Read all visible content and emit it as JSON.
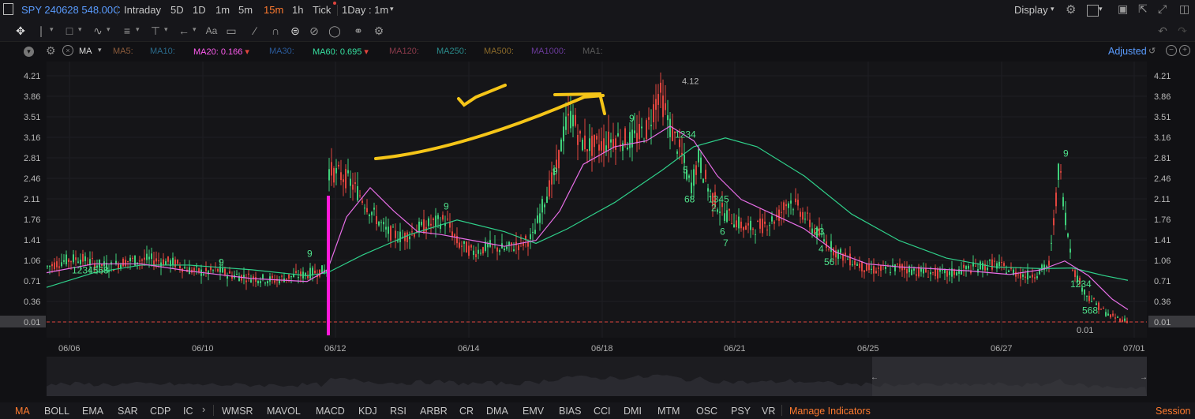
{
  "header": {
    "symbol": "SPY 240628 548.00C",
    "timeframes": [
      "Intraday",
      "5D",
      "1D",
      "1m",
      "5m",
      "15m",
      "1h",
      "Tick"
    ],
    "active_timeframe": "15m",
    "range_select": "1Day : 1m",
    "display_label": "Display"
  },
  "ma_legend": {
    "type_label": "MA",
    "items": [
      {
        "label": "MA5:",
        "value": "",
        "color": "#8a5a3a"
      },
      {
        "label": "MA10:",
        "value": "",
        "color": "#2a6a8a"
      },
      {
        "label": "MA20:",
        "value": "0.166",
        "color": "#ff5cf0"
      },
      {
        "label": "MA30:",
        "value": "",
        "color": "#2a5a9a"
      },
      {
        "label": "MA60:",
        "value": "0.695",
        "color": "#36e0a0"
      },
      {
        "label": "MA120:",
        "value": "",
        "color": "#8a3a4a"
      },
      {
        "label": "MA250:",
        "value": "",
        "color": "#2a8a8a"
      },
      {
        "label": "MA500:",
        "value": "",
        "color": "#8a6a2a"
      },
      {
        "label": "MA1000:",
        "value": "",
        "color": "#6a3a9a"
      },
      {
        "label": "MA1:",
        "value": "",
        "color": "#5a5a5a"
      }
    ],
    "adjusted_label": "Adjusted"
  },
  "chart_data": {
    "type": "candlestick",
    "y_ticks": [
      "4.21",
      "3.86",
      "3.51",
      "3.16",
      "2.81",
      "2.46",
      "2.11",
      "1.76",
      "1.41",
      "1.06",
      "0.71",
      "0.36",
      "0.01"
    ],
    "ylim": [
      0.01,
      4.21
    ],
    "x_ticks": [
      "06/06",
      "06/10",
      "06/12",
      "06/14",
      "06/18",
      "06/21",
      "06/25",
      "06/27",
      "07/01"
    ],
    "current_price": "0.01",
    "high_label": "4.12",
    "low_label": "0.01",
    "price_path": [
      [
        0,
        0.95
      ],
      [
        20,
        1.05
      ],
      [
        40,
        1.1
      ],
      [
        60,
        1.0
      ],
      [
        80,
        0.95
      ],
      [
        100,
        1.05
      ],
      [
        130,
        1.08
      ],
      [
        160,
        1.02
      ],
      [
        180,
        0.9
      ],
      [
        200,
        0.85
      ],
      [
        215,
        0.9
      ],
      [
        230,
        0.82
      ],
      [
        250,
        0.78
      ],
      [
        270,
        0.75
      ],
      [
        290,
        0.72
      ],
      [
        305,
        0.78
      ],
      [
        320,
        0.8
      ],
      [
        335,
        0.85
      ],
      [
        355,
        0.9
      ],
      [
        356,
        2.6
      ],
      [
        365,
        2.55
      ],
      [
        380,
        2.45
      ],
      [
        395,
        2.2
      ],
      [
        410,
        1.9
      ],
      [
        430,
        1.55
      ],
      [
        450,
        1.45
      ],
      [
        470,
        1.6
      ],
      [
        490,
        1.7
      ],
      [
        505,
        1.75
      ],
      [
        520,
        1.35
      ],
      [
        540,
        1.2
      ],
      [
        560,
        1.3
      ],
      [
        580,
        1.25
      ],
      [
        600,
        1.35
      ],
      [
        615,
        1.45
      ],
      [
        630,
        2.1
      ],
      [
        645,
        2.6
      ],
      [
        655,
        3.3
      ],
      [
        665,
        3.55
      ],
      [
        675,
        3.1
      ],
      [
        690,
        3.0
      ],
      [
        705,
        3.05
      ],
      [
        720,
        3.15
      ],
      [
        740,
        3.1
      ],
      [
        760,
        3.3
      ],
      [
        775,
        3.95
      ],
      [
        790,
        3.3
      ],
      [
        805,
        2.8
      ],
      [
        815,
        2.3
      ],
      [
        825,
        2.8
      ],
      [
        840,
        2.2
      ],
      [
        855,
        1.9
      ],
      [
        870,
        1.75
      ],
      [
        885,
        1.6
      ],
      [
        905,
        1.65
      ],
      [
        925,
        1.8
      ],
      [
        940,
        2.1
      ],
      [
        955,
        1.9
      ],
      [
        970,
        1.6
      ],
      [
        985,
        1.4
      ],
      [
        1000,
        1.2
      ],
      [
        1020,
        1.05
      ],
      [
        1040,
        0.9
      ],
      [
        1060,
        0.9
      ],
      [
        1080,
        0.95
      ],
      [
        1100,
        0.88
      ],
      [
        1120,
        0.85
      ],
      [
        1140,
        0.82
      ],
      [
        1160,
        0.9
      ],
      [
        1180,
        0.95
      ],
      [
        1200,
        1.0
      ],
      [
        1220,
        0.88
      ],
      [
        1240,
        0.8
      ],
      [
        1255,
        0.85
      ],
      [
        1270,
        1.0
      ],
      [
        1282,
        2.7
      ],
      [
        1290,
        1.8
      ],
      [
        1300,
        0.9
      ],
      [
        1315,
        0.5
      ],
      [
        1330,
        0.3
      ],
      [
        1345,
        0.12
      ],
      [
        1360,
        0.05
      ],
      [
        1370,
        0.02
      ]
    ],
    "ma20": [
      [
        0,
        0.85
      ],
      [
        60,
        1.0
      ],
      [
        120,
        1.0
      ],
      [
        180,
        0.88
      ],
      [
        260,
        0.75
      ],
      [
        330,
        0.7
      ],
      [
        356,
        0.9
      ],
      [
        380,
        1.8
      ],
      [
        410,
        2.3
      ],
      [
        440,
        1.9
      ],
      [
        470,
        1.55
      ],
      [
        500,
        1.5
      ],
      [
        540,
        1.4
      ],
      [
        580,
        1.3
      ],
      [
        620,
        1.4
      ],
      [
        650,
        1.9
      ],
      [
        680,
        2.7
      ],
      [
        720,
        3.0
      ],
      [
        760,
        3.1
      ],
      [
        790,
        3.35
      ],
      [
        820,
        3.1
      ],
      [
        850,
        2.5
      ],
      [
        880,
        2.1
      ],
      [
        920,
        1.85
      ],
      [
        960,
        1.6
      ],
      [
        1000,
        1.2
      ],
      [
        1040,
        1.0
      ],
      [
        1080,
        0.95
      ],
      [
        1120,
        0.92
      ],
      [
        1170,
        0.88
      ],
      [
        1220,
        0.82
      ],
      [
        1260,
        0.9
      ],
      [
        1290,
        1.05
      ],
      [
        1320,
        0.8
      ],
      [
        1350,
        0.4
      ],
      [
        1370,
        0.22
      ]
    ],
    "ma60": [
      [
        0,
        0.6
      ],
      [
        60,
        0.85
      ],
      [
        120,
        0.98
      ],
      [
        180,
        0.98
      ],
      [
        260,
        0.9
      ],
      [
        330,
        0.8
      ],
      [
        356,
        0.85
      ],
      [
        400,
        1.15
      ],
      [
        460,
        1.5
      ],
      [
        520,
        1.75
      ],
      [
        580,
        1.55
      ],
      [
        620,
        1.35
      ],
      [
        660,
        1.6
      ],
      [
        720,
        2.05
      ],
      [
        780,
        2.6
      ],
      [
        820,
        3.0
      ],
      [
        860,
        3.15
      ],
      [
        900,
        3.0
      ],
      [
        960,
        2.5
      ],
      [
        1020,
        1.85
      ],
      [
        1080,
        1.4
      ],
      [
        1140,
        1.1
      ],
      [
        1200,
        0.95
      ],
      [
        1260,
        0.92
      ],
      [
        1300,
        0.93
      ],
      [
        1340,
        0.8
      ],
      [
        1370,
        0.72
      ]
    ],
    "td_labels": [
      {
        "text": "9",
        "x": 218,
        "y": 0.97,
        "color": "#4fe08a"
      },
      {
        "text": "9",
        "x": 330,
        "y": 1.12,
        "color": "#4fe08a"
      },
      {
        "text": "9",
        "x": 503,
        "y": 1.93,
        "color": "#4fe08a"
      },
      {
        "text": "9",
        "x": 641,
        "y": 2.53,
        "color": "#4fe08a"
      },
      {
        "text": "9",
        "x": 738,
        "y": 3.43,
        "color": "#4fe08a"
      },
      {
        "text": "9",
        "x": 1288,
        "y": 2.83,
        "color": "#4fe08a"
      },
      {
        "text": "1234568",
        "x": 32,
        "y": 0.84,
        "color": "#4fe08a"
      },
      {
        "text": "1234",
        "x": 796,
        "y": 3.15,
        "color": "#4fe08a"
      },
      {
        "text": "5",
        "x": 806,
        "y": 2.55,
        "color": "#4fe08a"
      },
      {
        "text": "68",
        "x": 808,
        "y": 2.05,
        "color": "#4fe08a"
      },
      {
        "text": "1345",
        "x": 838,
        "y": 2.05,
        "color": "#4fe08a"
      },
      {
        "text": "2",
        "x": 842,
        "y": 1.9,
        "color": "#4fe08a"
      },
      {
        "text": "6",
        "x": 853,
        "y": 1.5,
        "color": "#4fe08a"
      },
      {
        "text": "7",
        "x": 857,
        "y": 1.3,
        "color": "#4fe08a"
      },
      {
        "text": "23",
        "x": 972,
        "y": 1.5,
        "color": "#4fe08a"
      },
      {
        "text": "4",
        "x": 978,
        "y": 1.2,
        "color": "#4fe08a"
      },
      {
        "text": "56",
        "x": 985,
        "y": 0.98,
        "color": "#4fe08a"
      },
      {
        "text": "1234",
        "x": 1297,
        "y": 0.6,
        "color": "#4fe08a"
      },
      {
        "text": "568",
        "x": 1312,
        "y": 0.15,
        "color": "#4fe08a"
      }
    ]
  },
  "bottom_indicators": {
    "main": [
      "MA",
      "BOLL",
      "EMA",
      "SAR",
      "CDP",
      "IC"
    ],
    "sub": [
      "WMSR",
      "MAVOL",
      "MACD",
      "KDJ",
      "RSI",
      "ARBR",
      "CR",
      "DMA",
      "EMV",
      "BIAS",
      "CCI",
      "DMI",
      "MTM",
      "OSC",
      "PSY",
      "VR"
    ],
    "manage_label": "Manage Indicators",
    "session_label": "Session",
    "active": "MA"
  },
  "colors": {
    "up": "#3fd07a",
    "down": "#e0453e",
    "ma20": "#e86ee8",
    "ma60": "#2fd08a",
    "accent": "#ff7a2f",
    "annotation_yellow": "#f5c518",
    "annotation_magenta": "#ff1ad9"
  }
}
